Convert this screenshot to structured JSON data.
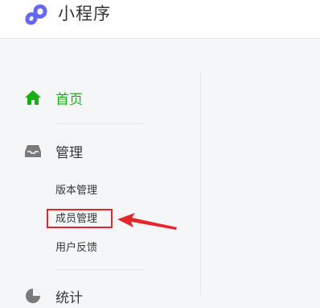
{
  "header": {
    "brand_name": "小程序",
    "brand_icon": "mini-program-logo",
    "brand_color": "#6467f0"
  },
  "sidebar": {
    "home": {
      "label": "首页",
      "icon": "home-icon",
      "color": "#1aad19"
    },
    "manage": {
      "label": "管理",
      "icon": "inbox-icon",
      "items": [
        {
          "label": "版本管理"
        },
        {
          "label": "成员管理",
          "highlighted": true
        },
        {
          "label": "用户反馈"
        }
      ]
    },
    "stats": {
      "label": "统计",
      "icon": "pie-chart-icon"
    }
  },
  "annotation": {
    "highlight_color": "#e3262a"
  }
}
